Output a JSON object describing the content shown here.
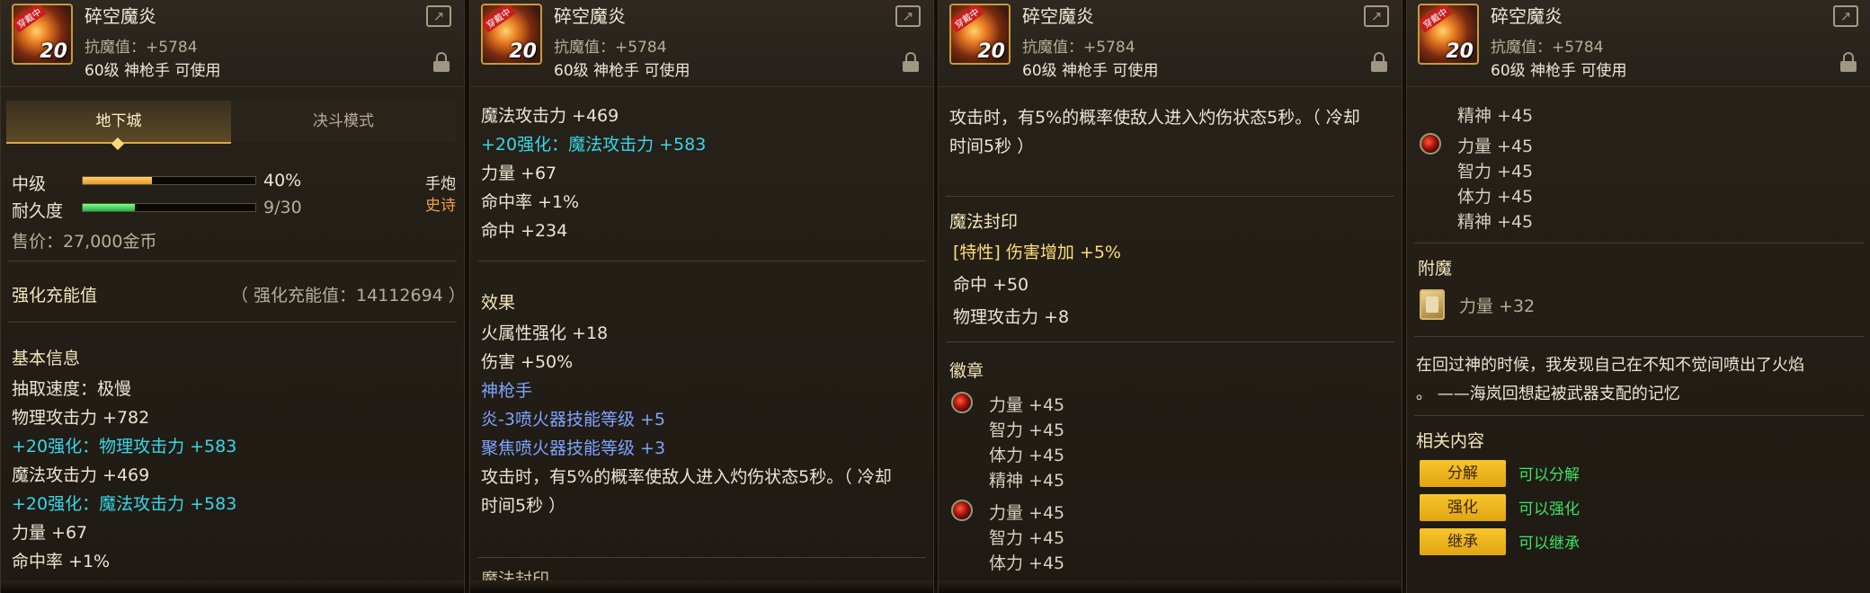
{
  "item": {
    "name": "碎空魔炎",
    "badge": "穿戴中",
    "level_badge": "20",
    "anti_magic": "抗魔值：+5784",
    "class_req": "60级 神枪手 可使用"
  },
  "panel1": {
    "tabs": [
      "地下城",
      "决斗模式"
    ],
    "grade_label": "中级",
    "grade_value": "40%",
    "grade_fraction": 0.4,
    "durability_label": "耐久度",
    "durability_value": "9/30",
    "durability_fraction": 0.3,
    "weapon_type": "手炮",
    "rarity": "史诗",
    "price": "售价：27,000金币",
    "charge_label": "强化充能值",
    "charge_value": "（ 强化充能值：14112694 ）",
    "basic_info": "基本信息",
    "lines": [
      "抽取速度：极慢",
      "物理攻击力 +782",
      "+20强化：物理攻击力 +583",
      "魔法攻击力 +469",
      "+20强化：魔法攻击力 +583",
      "力量 +67",
      "命中率 +1%"
    ]
  },
  "panel2": {
    "lines_top": [
      "魔法攻击力 +469",
      "+20强化：魔法攻击力 +583",
      "力量 +67",
      "命中率 +1%",
      "命中 +234"
    ],
    "effect_label": "效果",
    "effect_lines": [
      "火属性强化 +18",
      "伤害 +50%",
      "神枪手",
      "炎-3喷火器技能等级 +5",
      "聚焦喷火器技能等级 +3",
      "攻击时，有5%的概率使敌人进入灼伤状态5秒。（ 冷却",
      "时间5秒 ）"
    ],
    "cut_label": "魔法封印"
  },
  "panel3": {
    "lines_top": [
      "攻击时，有5%的概率使敌人进入灼伤状态5秒。（ 冷却",
      "时间5秒 ）"
    ],
    "seal_label": "魔法封印",
    "seal_lines": [
      "[特性] 伤害增加 +5%",
      "命中 +50",
      "物理攻击力 +8"
    ],
    "emblem_label": "徽章",
    "emblem1": [
      "力量 +45",
      "智力 +45",
      "体力 +45",
      "精神 +45"
    ],
    "emblem2": [
      "力量 +45",
      "智力 +45",
      "体力 +45"
    ]
  },
  "panel4": {
    "top_line": "精神 +45",
    "emblem": [
      "力量 +45",
      "智力 +45",
      "体力 +45",
      "精神 +45"
    ],
    "enchant_label": "附魔",
    "enchant_value": "力量 +32",
    "flavor": [
      "在回过神的时候，我发现自己在不知不觉间喷出了火焰",
      "。 ——海岚回想起被武器支配的记忆"
    ],
    "related_label": "相关内容",
    "actions": [
      {
        "button": "分解",
        "desc": "可以分解"
      },
      {
        "button": "强化",
        "desc": "可以强化"
      },
      {
        "button": "继承",
        "desc": "可以继承"
      }
    ]
  },
  "colors": {
    "enhance": "#35d8ea",
    "skill": "#7da4ff",
    "feature": "#ffdd7a",
    "epic": "#f0a040",
    "button": "#f8c52a",
    "action_text": "#3ee264"
  },
  "icons": [
    "item-icon",
    "share-icon",
    "lock-icon",
    "emblem-gem-icon",
    "enchant-card-icon"
  ]
}
